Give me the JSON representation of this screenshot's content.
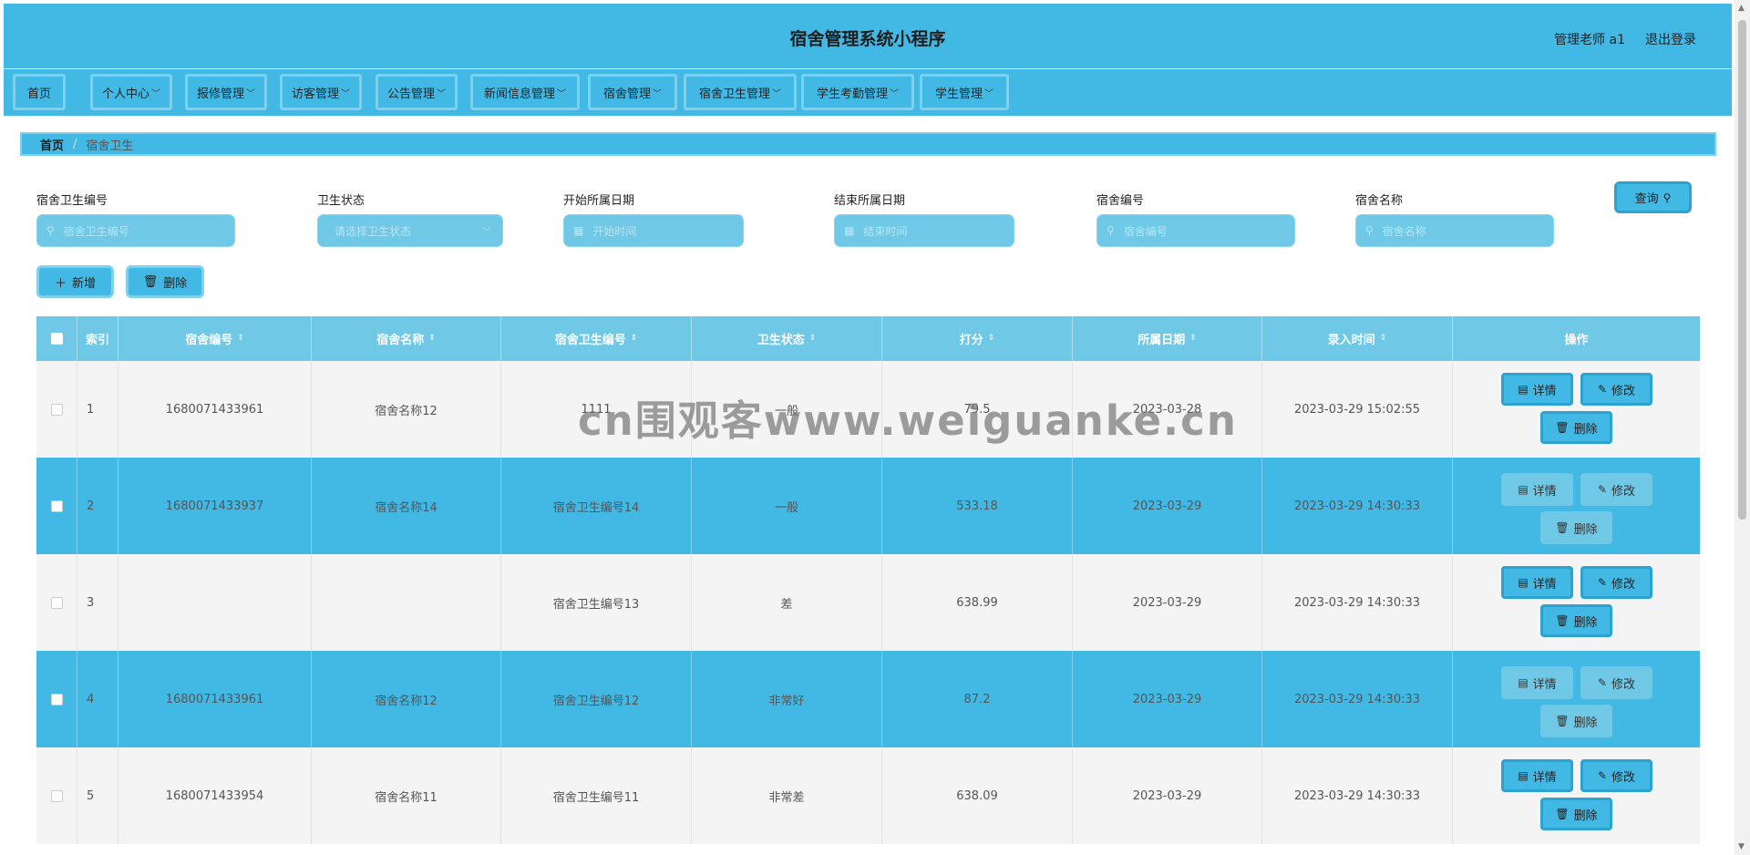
{
  "header": {
    "title": "宿舍管理系统小程序",
    "user": "管理老师 a1",
    "logout": "退出登录"
  },
  "nav": {
    "items": [
      {
        "label": "首页"
      },
      {
        "label": "个人中心"
      },
      {
        "label": "报修管理"
      },
      {
        "label": "访客管理"
      },
      {
        "label": "公告管理"
      },
      {
        "label": "新闻信息管理"
      },
      {
        "label": "宿舍管理"
      },
      {
        "label": "宿舍卫生管理"
      },
      {
        "label": "学生考勤管理"
      },
      {
        "label": "学生管理"
      }
    ]
  },
  "breadcrumb": {
    "home": "首页",
    "separator": "/",
    "current": "宿舍卫生"
  },
  "search": {
    "fields": [
      {
        "label": "宿舍卫生编号",
        "placeholder": "宿舍卫生编号"
      },
      {
        "label": "卫生状态",
        "placeholder": "请选择卫生状态"
      },
      {
        "label": "开始所属日期",
        "placeholder": "开始时间"
      },
      {
        "label": "结束所属日期",
        "placeholder": "结束时间"
      },
      {
        "label": "宿舍编号",
        "placeholder": "宿舍编号"
      },
      {
        "label": "宿舍名称",
        "placeholder": "宿舍名称"
      }
    ],
    "query": "查询"
  },
  "toolbar": {
    "add": "新增",
    "delete": "删除"
  },
  "table": {
    "columns": [
      "索引",
      "宿舍编号",
      "宿舍名称",
      "宿舍卫生编号",
      "卫生状态",
      "打分",
      "所属日期",
      "录入时间",
      "操作"
    ],
    "rows": [
      {
        "index": "1",
        "room_no": "1680071433961",
        "room_name": "宿舍名称12",
        "hygiene_no": "1111",
        "status": "一般",
        "score": "79.5",
        "date": "2023-03-28",
        "created": "2023-03-29 15:02:55"
      },
      {
        "index": "2",
        "room_no": "1680071433937",
        "room_name": "宿舍名称14",
        "hygiene_no": "宿舍卫生编号14",
        "status": "一般",
        "score": "533.18",
        "date": "2023-03-29",
        "created": "2023-03-29 14:30:33"
      },
      {
        "index": "3",
        "room_no": "",
        "room_name": "",
        "hygiene_no": "宿舍卫生编号13",
        "status": "差",
        "score": "638.99",
        "date": "2023-03-29",
        "created": "2023-03-29 14:30:33"
      },
      {
        "index": "4",
        "room_no": "1680071433961",
        "room_name": "宿舍名称12",
        "hygiene_no": "宿舍卫生编号12",
        "status": "非常好",
        "score": "87.2",
        "date": "2023-03-29",
        "created": "2023-03-29 14:30:33"
      },
      {
        "index": "5",
        "room_no": "1680071433954",
        "room_name": "宿舍名称11",
        "hygiene_no": "宿舍卫生编号11",
        "status": "非常差",
        "score": "638.09",
        "date": "2023-03-29",
        "created": "2023-03-29 14:30:33"
      }
    ],
    "actions": {
      "detail": "详情",
      "edit": "修改",
      "delete": "删除"
    }
  },
  "watermark": "cn围观客www.weiguanke.cn",
  "colors": {
    "primary": "#42b8e5",
    "light": "#6ec8e6",
    "border": "#7ed1ee",
    "row_alt": "#f4f4f4"
  }
}
